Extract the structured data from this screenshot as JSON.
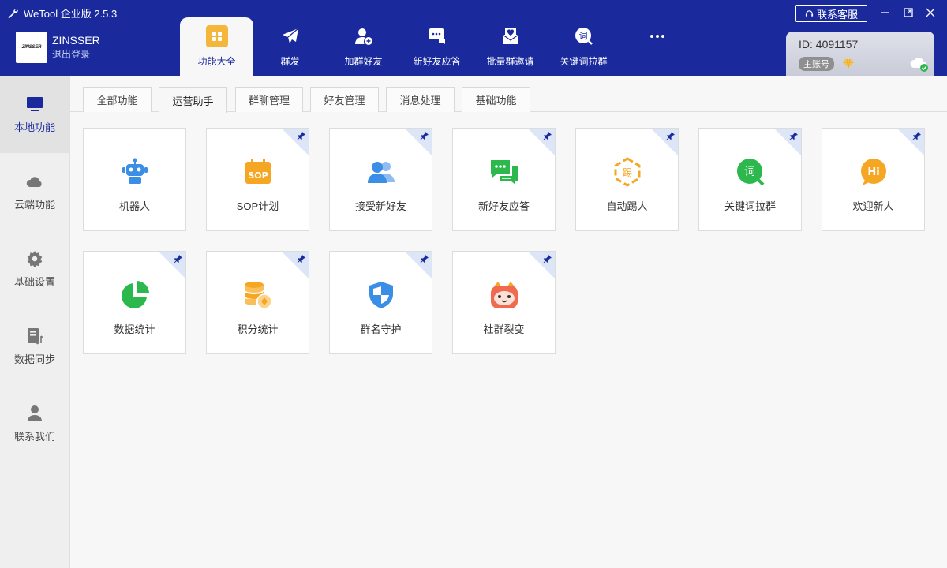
{
  "window": {
    "title": "WeTool 企业版 2.5.3",
    "service_button": "联系客服"
  },
  "user": {
    "logo_text": "ZINSSER",
    "name": "ZINSSER",
    "logout": "退出登录"
  },
  "nav": [
    {
      "label": "功能大全",
      "icon": "grid-icon",
      "active": true
    },
    {
      "label": "群发",
      "icon": "paper-plane-icon"
    },
    {
      "label": "加群好友",
      "icon": "add-friend-icon"
    },
    {
      "label": "新好友应答",
      "icon": "chat-reply-icon"
    },
    {
      "label": "批量群邀请",
      "icon": "invite-envelope-icon"
    },
    {
      "label": "关键词拉群",
      "icon": "keyword-icon",
      "glyph": "词"
    },
    {
      "label": "",
      "icon": "more-icon"
    }
  ],
  "account": {
    "id": "ID: 4091157",
    "badge": "主账号"
  },
  "sidebar": [
    {
      "label": "本地功能",
      "icon": "monitor-icon",
      "active": true
    },
    {
      "label": "云端功能",
      "icon": "cloud-icon"
    },
    {
      "label": "基础设置",
      "icon": "gear-icon"
    },
    {
      "label": "数据同步",
      "icon": "data-sync-icon"
    },
    {
      "label": "联系我们",
      "icon": "person-icon"
    }
  ],
  "tabs": [
    {
      "label": "全部功能"
    },
    {
      "label": "运营助手",
      "active": true
    },
    {
      "label": "群聊管理"
    },
    {
      "label": "好友管理"
    },
    {
      "label": "消息处理"
    },
    {
      "label": "基础功能"
    }
  ],
  "cards": [
    {
      "label": "机器人",
      "icon": "robot-icon",
      "pinned": false,
      "color": "#3a8ee6"
    },
    {
      "label": "SOP计划",
      "icon": "sop-icon",
      "pinned": true,
      "color": "#f5a623",
      "glyph": "SOP"
    },
    {
      "label": "接受新好友",
      "icon": "users-icon",
      "pinned": true,
      "color": "#3a8ee6"
    },
    {
      "label": "新好友应答",
      "icon": "chat-bubbles-icon",
      "pinned": true,
      "color": "#2db84d"
    },
    {
      "label": "自动踢人",
      "icon": "kick-icon",
      "pinned": true,
      "color": "#f5a623",
      "glyph": "踢"
    },
    {
      "label": "关键词拉群",
      "icon": "keyword-search-icon",
      "pinned": true,
      "color": "#2db84d",
      "glyph": "词"
    },
    {
      "label": "欢迎新人",
      "icon": "hi-icon",
      "pinned": true,
      "color": "#f5a623",
      "glyph": "Hi"
    },
    {
      "label": "数据统计",
      "icon": "pie-chart-icon",
      "pinned": true,
      "color": "#2db84d"
    },
    {
      "label": "积分统计",
      "icon": "coins-icon",
      "pinned": true,
      "color": "#f5a623"
    },
    {
      "label": "群名守护",
      "icon": "shield-icon",
      "pinned": true,
      "color": "#3a8ee6"
    },
    {
      "label": "社群裂变",
      "icon": "mascot-icon",
      "pinned": true,
      "color": "#f06a4f"
    }
  ],
  "colors": {
    "header": "#1a2a9c",
    "accent": "#f5b73b"
  }
}
